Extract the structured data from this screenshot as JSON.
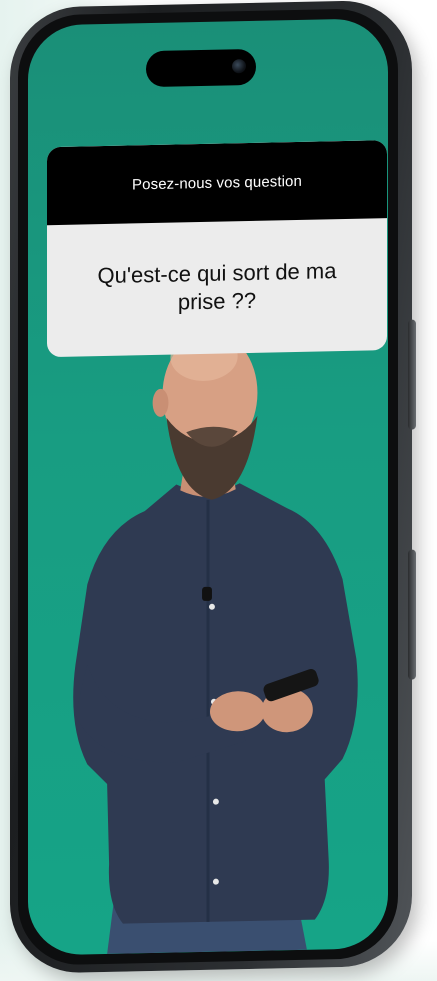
{
  "story": {
    "sticker_header": "Posez-nous vos question",
    "question_text": "Qu'est-ce qui sort de ma prise ??"
  },
  "colors": {
    "screen_background": "#189d82",
    "sticker_header_bg": "#000000",
    "sticker_body_bg": "#ececec",
    "shirt": "#2f3a52",
    "jeans": "#3a4f70"
  },
  "icons": {
    "camera": "front-camera-icon"
  }
}
